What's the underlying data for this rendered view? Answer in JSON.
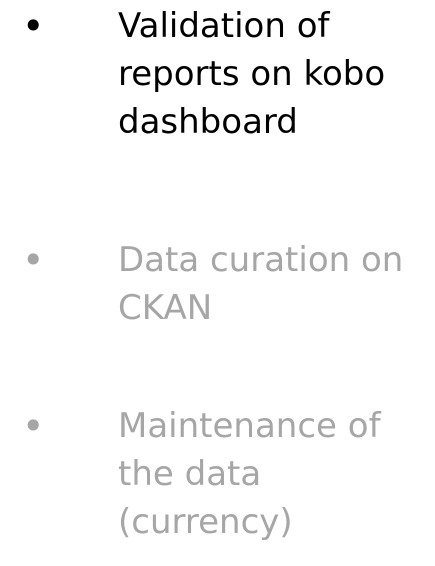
{
  "slide": {
    "bullets": [
      {
        "marker": "•",
        "text": "Validation of\nreports on kobo\ndashboard",
        "color": "#000000"
      },
      {
        "marker": "•",
        "text": "Data curation on\nCKAN",
        "color": "#a6a6a6"
      },
      {
        "marker": "•",
        "text": "Maintenance of\nthe data\n(currency)",
        "color": "#a6a6a6"
      }
    ]
  }
}
